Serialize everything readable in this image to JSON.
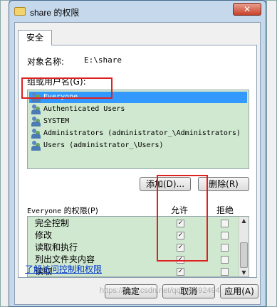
{
  "window": {
    "title": "share 的权限",
    "close_label": "✕"
  },
  "tab": {
    "label": "安全"
  },
  "object": {
    "label": "对象名称:",
    "value": "E:\\share"
  },
  "groups": {
    "label": "组或用户名(G):",
    "items": [
      {
        "name": "Everyone"
      },
      {
        "name": "Authenticated Users"
      },
      {
        "name": "SYSTEM"
      },
      {
        "name": "Administrators (administrator_\\Administrators)"
      },
      {
        "name": "Users (administrator_\\Users)"
      }
    ]
  },
  "buttons": {
    "add": "添加(D)...",
    "remove": "删除(R)",
    "ok": "确定",
    "cancel": "取消",
    "apply": "应用(A)"
  },
  "permissions": {
    "header_prefix": "Everyone",
    "header_suffix": " 的权限(P)",
    "allow_label": "允许",
    "deny_label": "拒绝",
    "rows": [
      {
        "name": "完全控制",
        "allow": "✓",
        "deny": ""
      },
      {
        "name": "修改",
        "allow": "✓",
        "deny": ""
      },
      {
        "name": "读取和执行",
        "allow": "✓",
        "deny": ""
      },
      {
        "name": "列出文件夹内容",
        "allow": "✓",
        "deny": ""
      },
      {
        "name": "读取",
        "allow": "✓",
        "deny": ""
      }
    ]
  },
  "link": {
    "label": "了解访问控制和权限"
  },
  "watermark": "https://blog.csdn.net/qq_35492494",
  "colors": {
    "highlight": "#3399ff",
    "annotation": "#e02020",
    "list_bg": "#cfe8cf"
  }
}
